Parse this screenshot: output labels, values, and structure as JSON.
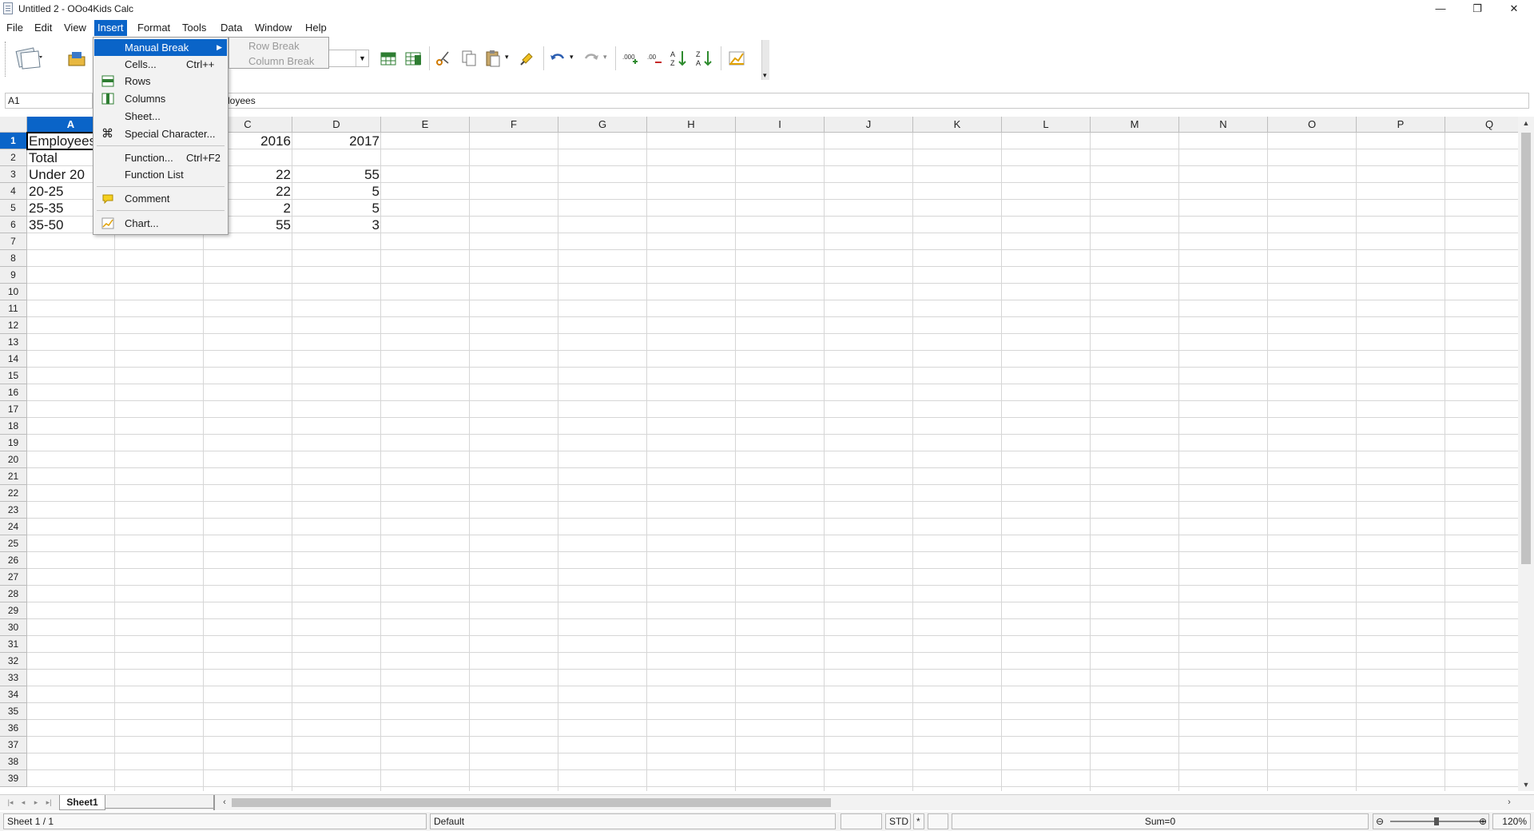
{
  "window": {
    "title": "Untitled 2 - OOo4Kids Calc",
    "minimize": "—",
    "restore": "❐",
    "close": "✕"
  },
  "menubar": {
    "items": [
      "File",
      "Edit",
      "View",
      "Insert",
      "Format",
      "Tools",
      "Data",
      "Window",
      "Help"
    ],
    "active": "Insert"
  },
  "toolbar": {
    "icons": [
      "new-document-icon",
      "open-folder-icon",
      "font-size-combo",
      "insert-sheet-icon",
      "insert-sheet-from-file-icon",
      "cut-icon",
      "copy-icon",
      "paste-icon",
      "clone-formatting-icon",
      "undo-icon",
      "redo-icon",
      "add-decimal-icon",
      "delete-decimal-icon",
      "sort-ascending-icon",
      "sort-descending-icon",
      "insert-chart-icon"
    ]
  },
  "formula_bar": {
    "name_box": "A1",
    "content": "loyees"
  },
  "insert_menu": {
    "items": [
      {
        "label": "Manual Break",
        "accel": "",
        "submenu": true,
        "highlighted": true
      },
      {
        "label": "Cells...",
        "accel": "Ctrl++"
      },
      {
        "label": "Rows",
        "accel": "",
        "icon": "insert-rows-icon"
      },
      {
        "label": "Columns",
        "accel": "",
        "icon": "insert-columns-icon"
      },
      {
        "label": "Sheet...",
        "accel": ""
      },
      {
        "label": "Special Character...",
        "accel": "",
        "icon": "special-character-icon"
      },
      {
        "label": "Function...",
        "accel": "Ctrl+F2"
      },
      {
        "label": "Function List",
        "accel": ""
      },
      {
        "label": "Comment",
        "accel": "",
        "icon": "comment-icon"
      },
      {
        "label": "Chart...",
        "accel": "",
        "icon": "chart-icon"
      }
    ],
    "submenu": [
      "Row Break",
      "Column Break"
    ]
  },
  "sheet": {
    "columns": [
      "A",
      "B",
      "C",
      "D",
      "E",
      "F",
      "G",
      "H",
      "I",
      "J",
      "K",
      "L",
      "M",
      "N",
      "O",
      "P",
      "Q"
    ],
    "selected_column": "A",
    "rows": [
      "1",
      "2",
      "3",
      "4",
      "5",
      "6",
      "7",
      "8",
      "9",
      "10",
      "11",
      "12",
      "13",
      "14",
      "15",
      "16",
      "17",
      "18",
      "19",
      "20",
      "21",
      "22",
      "23",
      "24",
      "25",
      "26",
      "27",
      "28",
      "29",
      "30",
      "31",
      "32",
      "33",
      "34",
      "35",
      "36",
      "37",
      "38",
      "39"
    ],
    "selected_row": "1",
    "cells": {
      "A1": "Employees",
      "C1": "2016",
      "D1": "2017",
      "A2": "Total",
      "A3": "Under 20",
      "C3": "22",
      "D3": "55",
      "A4": "20-25",
      "C4": "22",
      "D4": "5",
      "A5": "25-35",
      "C5": "2",
      "D5": "5",
      "A6": "35-50",
      "C6": "55",
      "D6": "3"
    }
  },
  "tabs": {
    "sheet_tab": "Sheet1",
    "nav": [
      "|◂",
      "◂",
      "▸",
      "▸|"
    ]
  },
  "statusbar": {
    "sheet": "Sheet 1 / 1",
    "page_style": "Default",
    "mode": "STD",
    "modified": "*",
    "sum": "Sum=0",
    "zoom": "120%",
    "zoom_level_percent": 120
  }
}
